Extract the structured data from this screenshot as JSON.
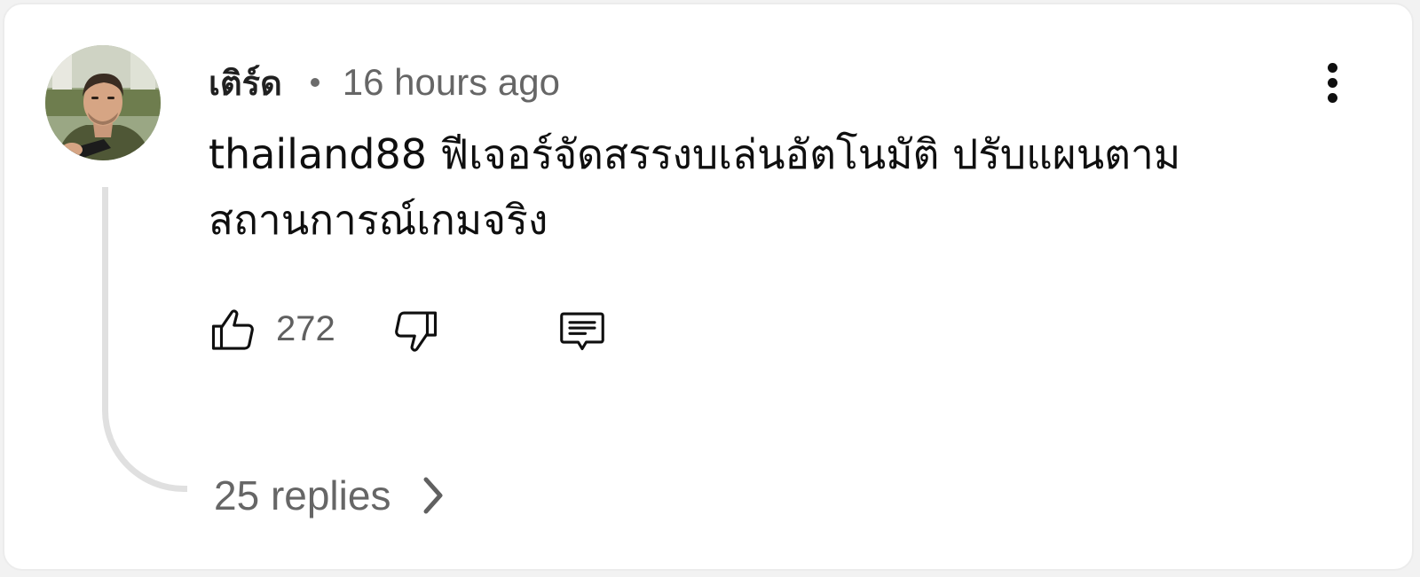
{
  "comment": {
    "author": "เติร์ด",
    "timestamp": "16 hours ago",
    "text": "thailand88 ฟีเจอร์จัดสรรงบเล่นอัตโนมัติ ปรับแผนตาม สถานการณ์เกมจริง",
    "like_count": "272",
    "replies_label": "25 replies"
  },
  "icons": {
    "avatar": "avatar",
    "more": "more-vert-icon",
    "like": "thumbs-up-icon",
    "dislike": "thumbs-down-icon",
    "reply": "comment-reply-icon",
    "expand": "chevron-right-icon"
  },
  "colors": {
    "text_primary": "#0f0f0f",
    "text_secondary": "#666666",
    "thread_line": "#e0e0e0"
  }
}
